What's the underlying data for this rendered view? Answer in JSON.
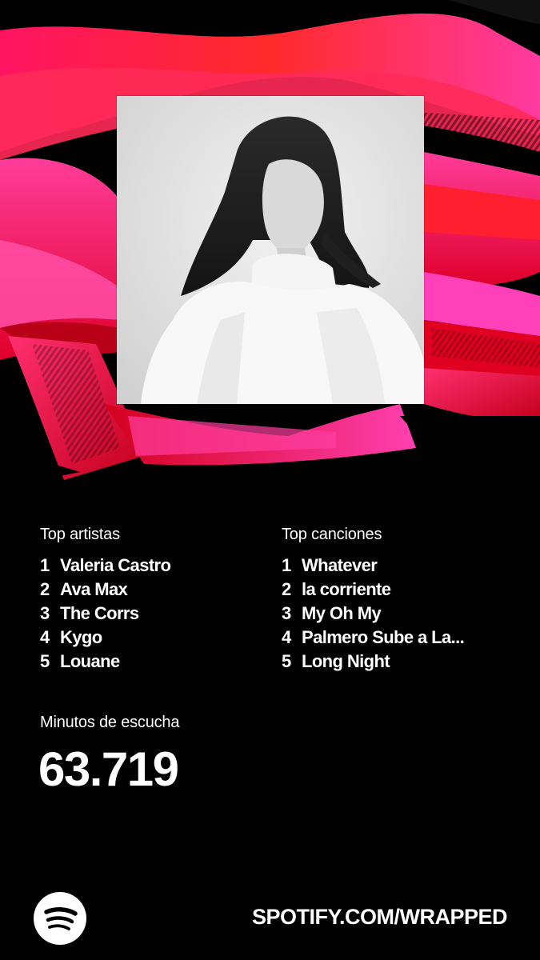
{
  "top_artists": {
    "heading": "Top artistas",
    "items": [
      {
        "rank": "1",
        "name": "Valeria Castro"
      },
      {
        "rank": "2",
        "name": "Ava Max"
      },
      {
        "rank": "3",
        "name": "The Corrs"
      },
      {
        "rank": "4",
        "name": "Kygo"
      },
      {
        "rank": "5",
        "name": "Louane"
      }
    ]
  },
  "top_songs": {
    "heading": "Top canciones",
    "items": [
      {
        "rank": "1",
        "name": "Whatever"
      },
      {
        "rank": "2",
        "name": "la corriente"
      },
      {
        "rank": "3",
        "name": "My Oh My"
      },
      {
        "rank": "4",
        "name": "Palmero Sube a La..."
      },
      {
        "rank": "5",
        "name": "Long Night"
      }
    ]
  },
  "minutes": {
    "label": "Minutos de escucha",
    "value": "63.719"
  },
  "footer": {
    "url": "SPOTIFY.COM/WRAPPED",
    "logo_icon": "spotify-logo-icon"
  },
  "colors": {
    "background": "#000000",
    "accent_red": "#ff1a1a",
    "accent_pink": "#ff2d8a",
    "text": "#ffffff"
  }
}
